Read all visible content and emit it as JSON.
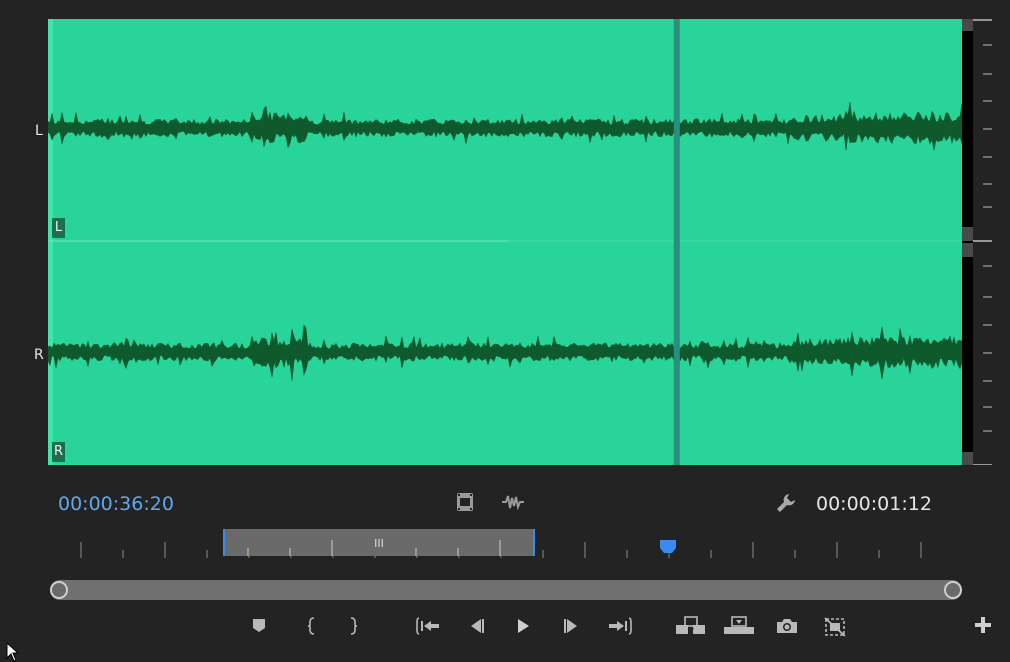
{
  "channels": {
    "left_label": "L",
    "right_label": "R",
    "left_badge": "L",
    "right_badge": "R"
  },
  "colors": {
    "waveform_bg": "#29d49b",
    "waveform_fill": "#0f5a2c",
    "playhead": "#2a8f7f",
    "timecode_accent": "#5fa8ef",
    "marker": "#3b8cf0"
  },
  "timecodes": {
    "current": "00:00:36:20",
    "duration": "00:00:01:12"
  },
  "viewer_controls": {
    "drag_video_icon": "film-strip-icon",
    "drag_audio_icon": "audio-waveform-icon",
    "settings_icon": "wrench-icon"
  },
  "playback": {
    "playhead_fraction": 0.688,
    "in_out_zoom_start_fraction": 0.19,
    "in_out_zoom_end_fraction": 0.53,
    "marker_fraction": 0.68
  },
  "transport_buttons": [
    {
      "name": "add-marker-button",
      "icon": "marker-icon"
    },
    {
      "name": "mark-in-button",
      "icon": "mark-in-icon"
    },
    {
      "name": "mark-out-button",
      "icon": "mark-out-icon"
    },
    {
      "name": "go-to-in-button",
      "icon": "go-to-in-icon"
    },
    {
      "name": "step-back-button",
      "icon": "step-back-icon"
    },
    {
      "name": "play-button",
      "icon": "play-icon"
    },
    {
      "name": "step-forward-button",
      "icon": "step-forward-icon"
    },
    {
      "name": "go-to-out-button",
      "icon": "go-to-out-icon"
    },
    {
      "name": "insert-button",
      "icon": "insert-icon"
    },
    {
      "name": "overwrite-button",
      "icon": "overwrite-icon"
    },
    {
      "name": "export-frame-button",
      "icon": "camera-icon"
    },
    {
      "name": "proxy-toggle-button",
      "icon": "proxy-icon"
    },
    {
      "name": "button-editor-button",
      "icon": "plus-icon"
    }
  ]
}
